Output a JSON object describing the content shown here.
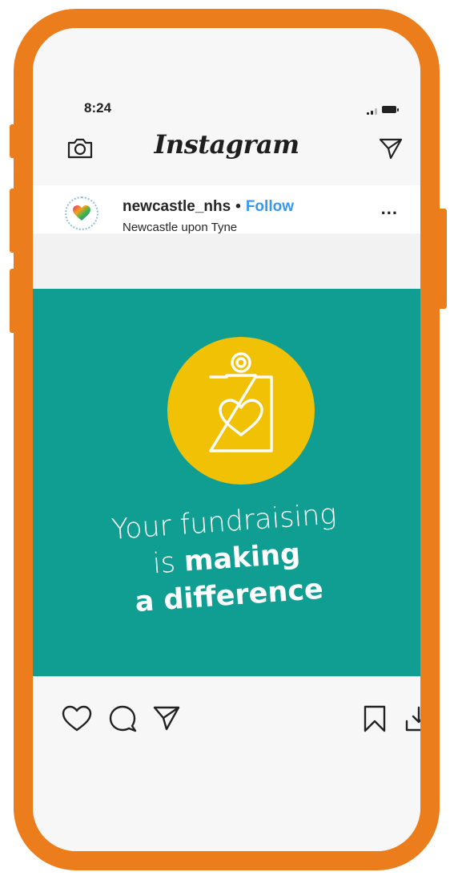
{
  "status_bar": {
    "time": "8:24"
  },
  "header": {
    "title": "Instagram",
    "left_icon": "camera-icon",
    "right_icon": "paper-plane-icon"
  },
  "post": {
    "username": "newcastle_nhs",
    "separator": "•",
    "follow_label": "Follow",
    "location": "Newcastle upon Tyne",
    "more_label": "...",
    "image": {
      "line1": "Your fundraising",
      "line2_thin": "is ",
      "line2_bold": "making",
      "line3": "a difference",
      "icon": "donation-box-heart-icon"
    }
  },
  "actions": {
    "like_icon": "heart-icon",
    "comment_icon": "comment-icon",
    "share_icon": "paper-plane-icon",
    "save_icon": "bookmark-icon",
    "download_icon": "download-icon"
  },
  "colors": {
    "frame": "#ec7d1c",
    "post_background": "#109e92",
    "circle": "#f0c105",
    "follow": "#3897f0"
  }
}
